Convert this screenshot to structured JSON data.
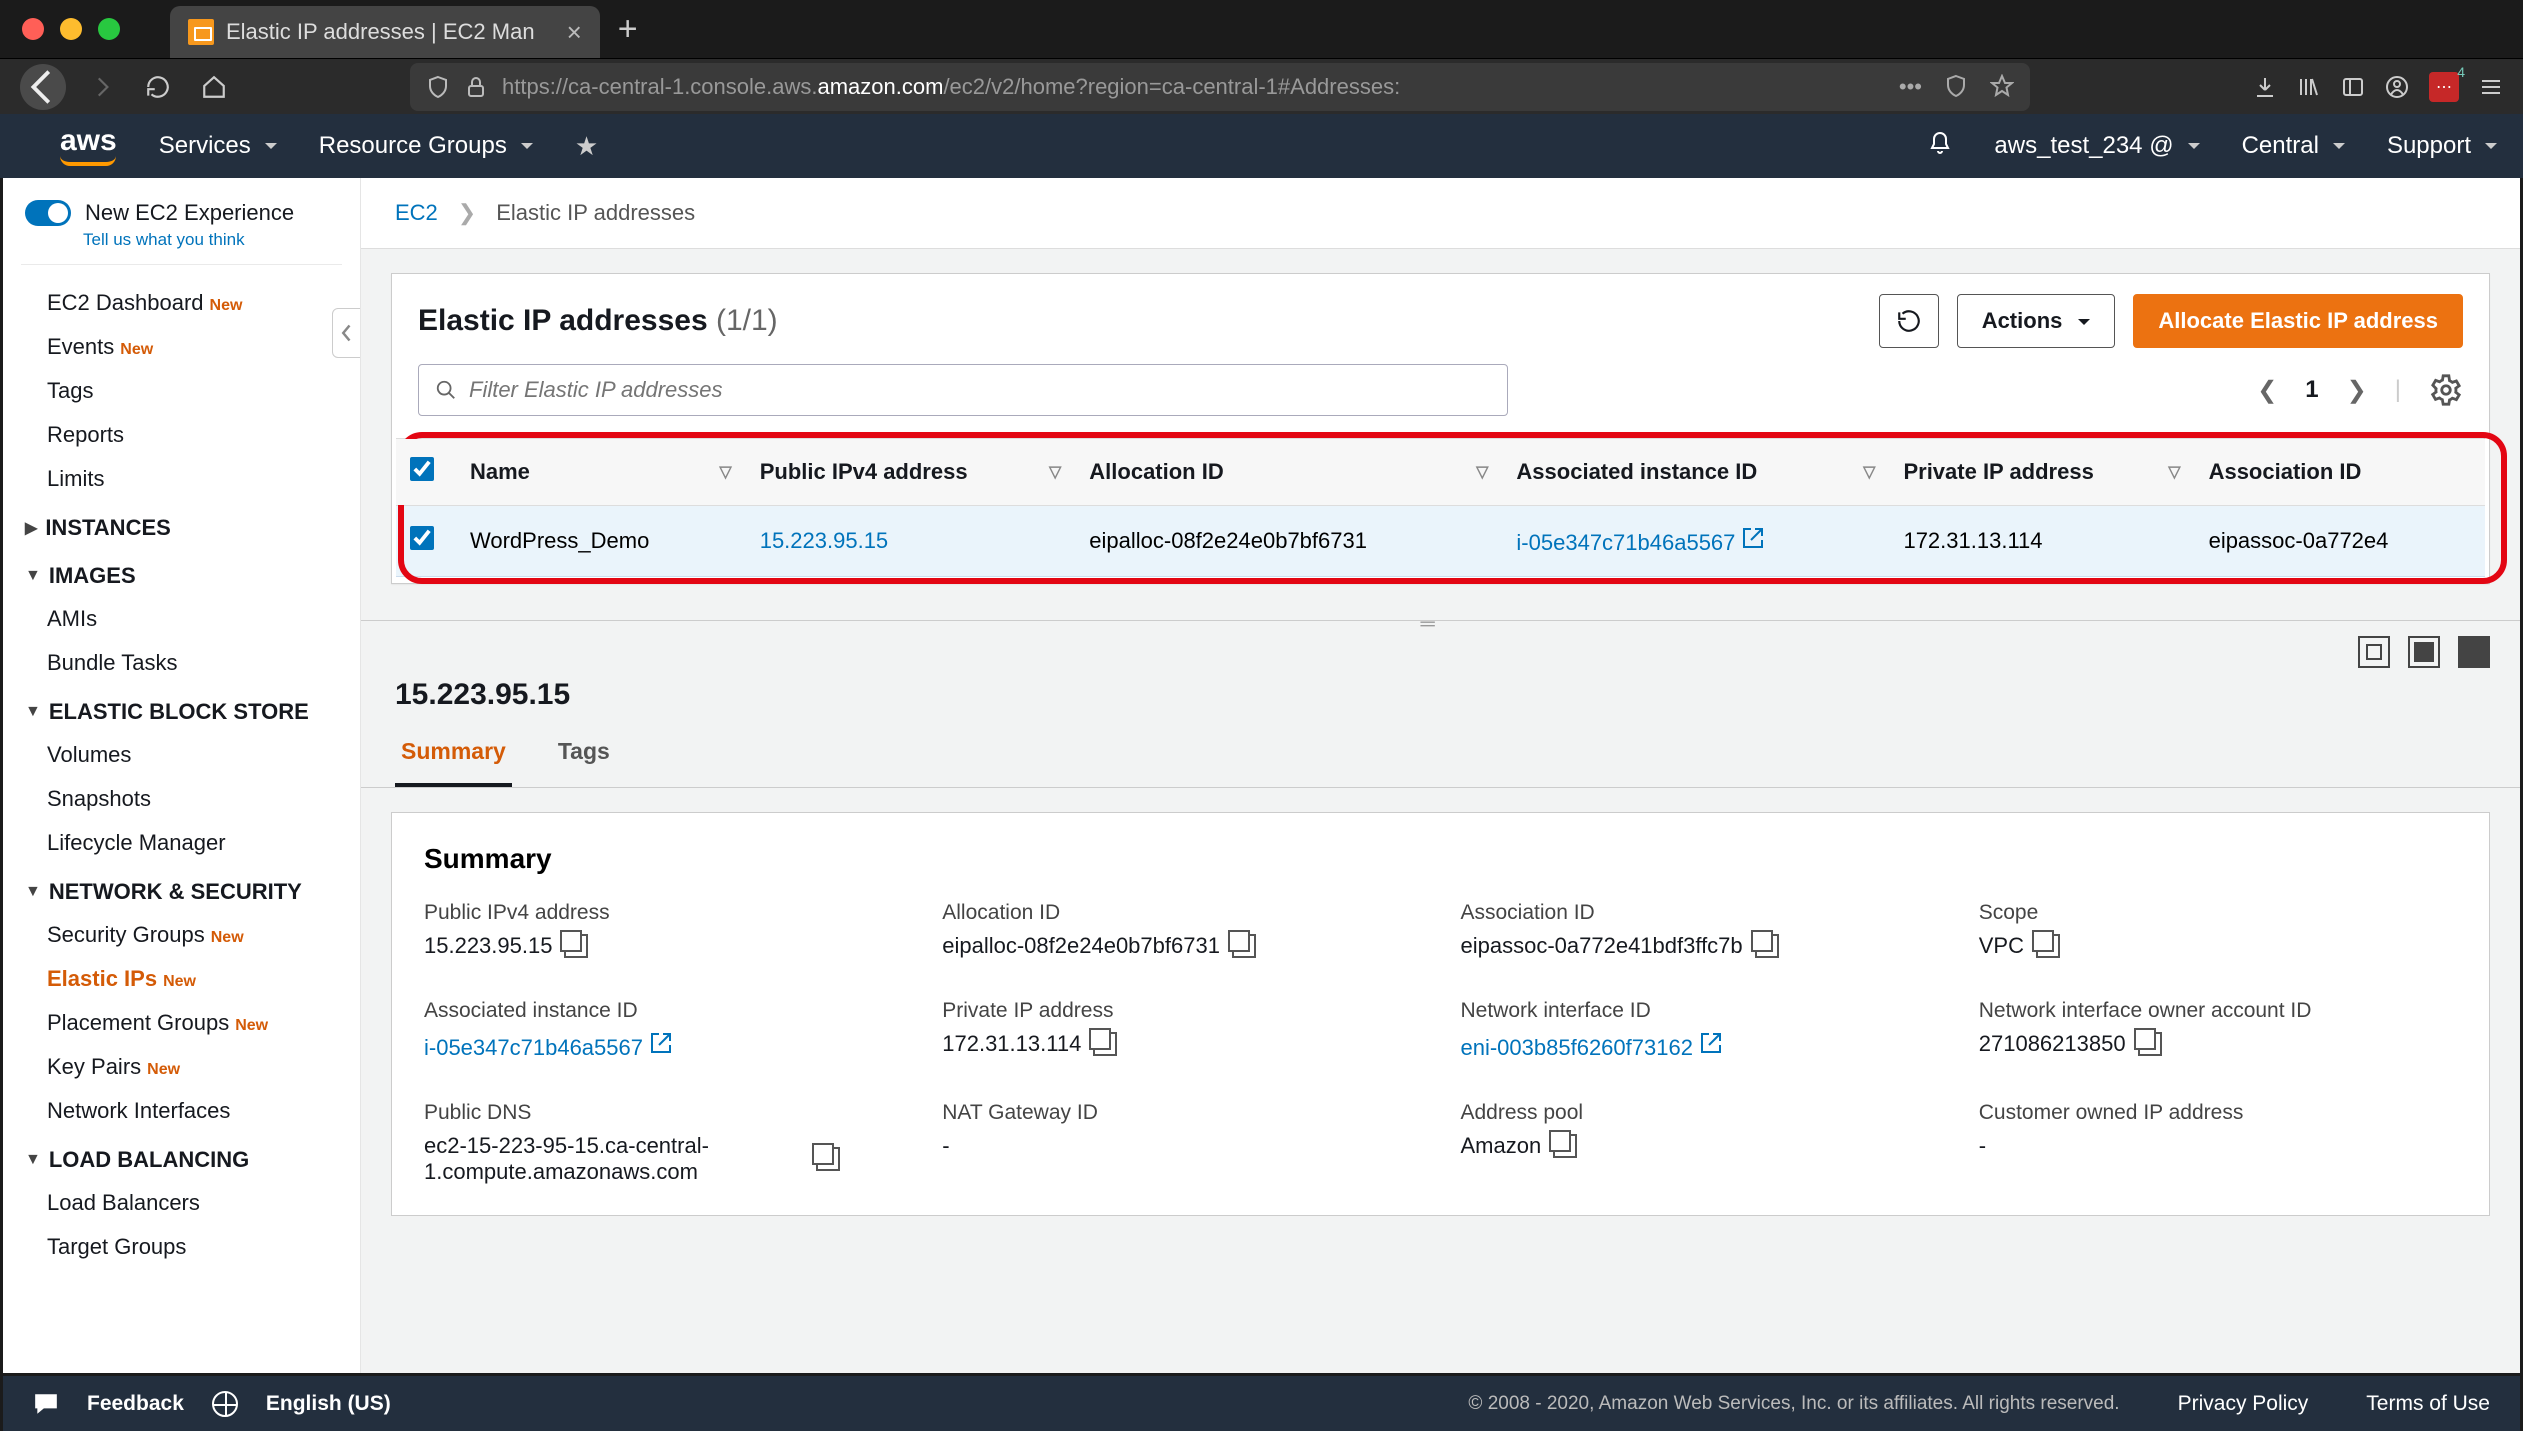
{
  "browser": {
    "tab_title": "Elastic IP addresses | EC2 Man",
    "url_prefix": "https://ca-central-1.console.aws.",
    "url_host": "amazon.com",
    "url_rest": "/ec2/v2/home?region=ca-central-1#Addresses:",
    "ext_badge": "4"
  },
  "nav": {
    "services": "Services",
    "resource_groups": "Resource Groups",
    "user": "aws_test_234 @",
    "region": "Central",
    "support": "Support"
  },
  "sidebar": {
    "new_exp": "New EC2 Experience",
    "new_exp_sub": "Tell us what you think",
    "dashboard": "EC2 Dashboard",
    "events": "Events",
    "tags": "Tags",
    "reports": "Reports",
    "limits": "Limits",
    "sec_instances": "INSTANCES",
    "sec_images": "IMAGES",
    "amis": "AMIs",
    "bundle": "Bundle Tasks",
    "sec_ebs": "ELASTIC BLOCK STORE",
    "volumes": "Volumes",
    "snapshots": "Snapshots",
    "lifecycle": "Lifecycle Manager",
    "sec_net": "NETWORK & SECURITY",
    "secgroups": "Security Groups",
    "eips": "Elastic IPs",
    "placement": "Placement Groups",
    "keypairs": "Key Pairs",
    "nics": "Network Interfaces",
    "sec_lb": "LOAD BALANCING",
    "lbs": "Load Balancers",
    "tg": "Target Groups",
    "new": "New"
  },
  "breadcrumb": {
    "root": "EC2",
    "current": "Elastic IP addresses"
  },
  "panel": {
    "title": "Elastic IP addresses",
    "count": "(1/1)",
    "actions": "Actions",
    "allocate": "Allocate Elastic IP address",
    "filter_placeholder": "Filter Elastic IP addresses",
    "page": "1"
  },
  "table": {
    "cols": {
      "name": "Name",
      "ip": "Public IPv4 address",
      "alloc": "Allocation ID",
      "inst": "Associated instance ID",
      "priv": "Private IP address",
      "assoc": "Association ID"
    },
    "row": {
      "name": "WordPress_Demo",
      "ip": "15.223.95.15",
      "alloc": "eipalloc-08f2e24e0b7bf6731",
      "inst": "i-05e347c71b46a5567",
      "priv": "172.31.13.114",
      "assoc": "eipassoc-0a772e4"
    }
  },
  "detail": {
    "ip_heading": "15.223.95.15",
    "tab_summary": "Summary",
    "tab_tags": "Tags",
    "summary_heading": "Summary",
    "fields": {
      "pub_ip_l": "Public IPv4 address",
      "pub_ip_v": "15.223.95.15",
      "alloc_l": "Allocation ID",
      "alloc_v": "eipalloc-08f2e24e0b7bf6731",
      "assoc_l": "Association ID",
      "assoc_v": "eipassoc-0a772e41bdf3ffc7b",
      "scope_l": "Scope",
      "scope_v": "VPC",
      "inst_l": "Associated instance ID",
      "inst_v": "i-05e347c71b46a5567",
      "priv_l": "Private IP address",
      "priv_v": "172.31.13.114",
      "eni_l": "Network interface ID",
      "eni_v": "eni-003b85f6260f73162",
      "owner_l": "Network interface owner account ID",
      "owner_v": "271086213850",
      "dns_l": "Public DNS",
      "dns_v": "ec2-15-223-95-15.ca-central-1.compute.amazonaws.com",
      "nat_l": "NAT Gateway ID",
      "nat_v": "-",
      "pool_l": "Address pool",
      "pool_v": "Amazon",
      "cust_l": "Customer owned IP address",
      "cust_v": "-"
    }
  },
  "footer": {
    "feedback": "Feedback",
    "lang": "English (US)",
    "copyright": "© 2008 - 2020, Amazon Web Services, Inc. or its affiliates. All rights reserved.",
    "privacy": "Privacy Policy",
    "terms": "Terms of Use"
  }
}
